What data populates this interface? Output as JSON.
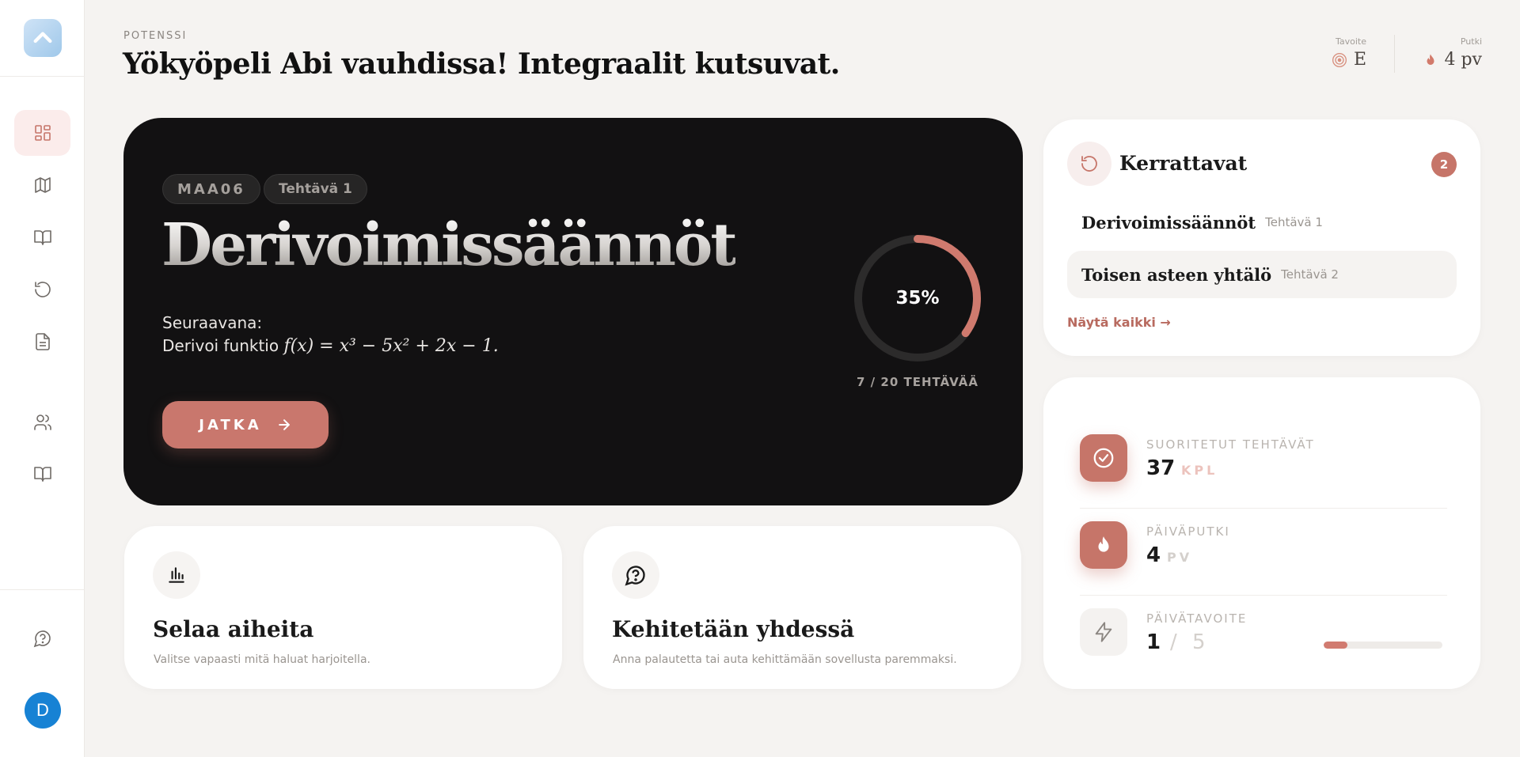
{
  "header": {
    "eyebrow": "POTENSSI",
    "title": "Yökyöpeli Abi vauhdissa! Integraalit kutsuvat.",
    "target": {
      "label": "Tavoite",
      "value": "E",
      "icon": "target-icon"
    },
    "streak": {
      "label": "Putki",
      "value": "4 pv",
      "icon": "flame-icon"
    }
  },
  "sidebar": {
    "items": [
      {
        "name": "dashboard",
        "icon": "dashboard-icon",
        "active": true
      },
      {
        "name": "map",
        "icon": "map-icon",
        "active": false
      },
      {
        "name": "book",
        "icon": "book-open-icon",
        "active": false
      },
      {
        "name": "review",
        "icon": "rotate-ccw-icon",
        "active": false
      },
      {
        "name": "documents",
        "icon": "document-icon",
        "active": false
      },
      {
        "name": "users",
        "icon": "users-icon",
        "active": false
      },
      {
        "name": "library",
        "icon": "book-open-icon",
        "active": false
      }
    ],
    "help_icon": "help-circle-icon",
    "avatar_initial": "D"
  },
  "hero": {
    "course_chip": "MAA06",
    "task_chip": "Tehtävä 1",
    "title": "Derivoimissäännöt",
    "next_label": "Seuraavana:",
    "next_prefix": "Derivoi funktio",
    "next_formula": "f(x) = x³ − 5x² + 2x − 1.",
    "button_label": "JATKA",
    "progress_percent": 35,
    "progress_label": "35%",
    "progress_caption": "7 / 20 TEHTÄVÄÄ"
  },
  "cards": {
    "browse": {
      "title": "Selaa aiheita",
      "description": "Valitse vapaasti mitä haluat harjoitella."
    },
    "feedback": {
      "title": "Kehitetään yhdessä",
      "description": "Anna palautetta tai auta kehittämään sovellusta paremmaksi."
    }
  },
  "review": {
    "title": "Kerrattavat",
    "count": "2",
    "items": [
      {
        "name": "Derivoimissäännöt",
        "task": "Tehtävä 1"
      },
      {
        "name": "Toisen asteen yhtälö",
        "task": "Tehtävä 2"
      }
    ],
    "show_all": "Näytä kaikki →"
  },
  "stats": {
    "completed": {
      "label": "SUORITETUT TEHTÄVÄT",
      "value": "37",
      "unit": "KPL"
    },
    "streak": {
      "label": "PÄIVÄPUTKI",
      "value": "4",
      "unit": "PV"
    },
    "goal": {
      "label": "PÄIVÄTAVOITE",
      "value": "1",
      "separator": "/",
      "total": "5",
      "progress": 0.2
    }
  },
  "colors": {
    "accent": "#c67569",
    "hero_bg": "#121112",
    "background": "#f5f3f1",
    "avatar": "#1782d4"
  }
}
